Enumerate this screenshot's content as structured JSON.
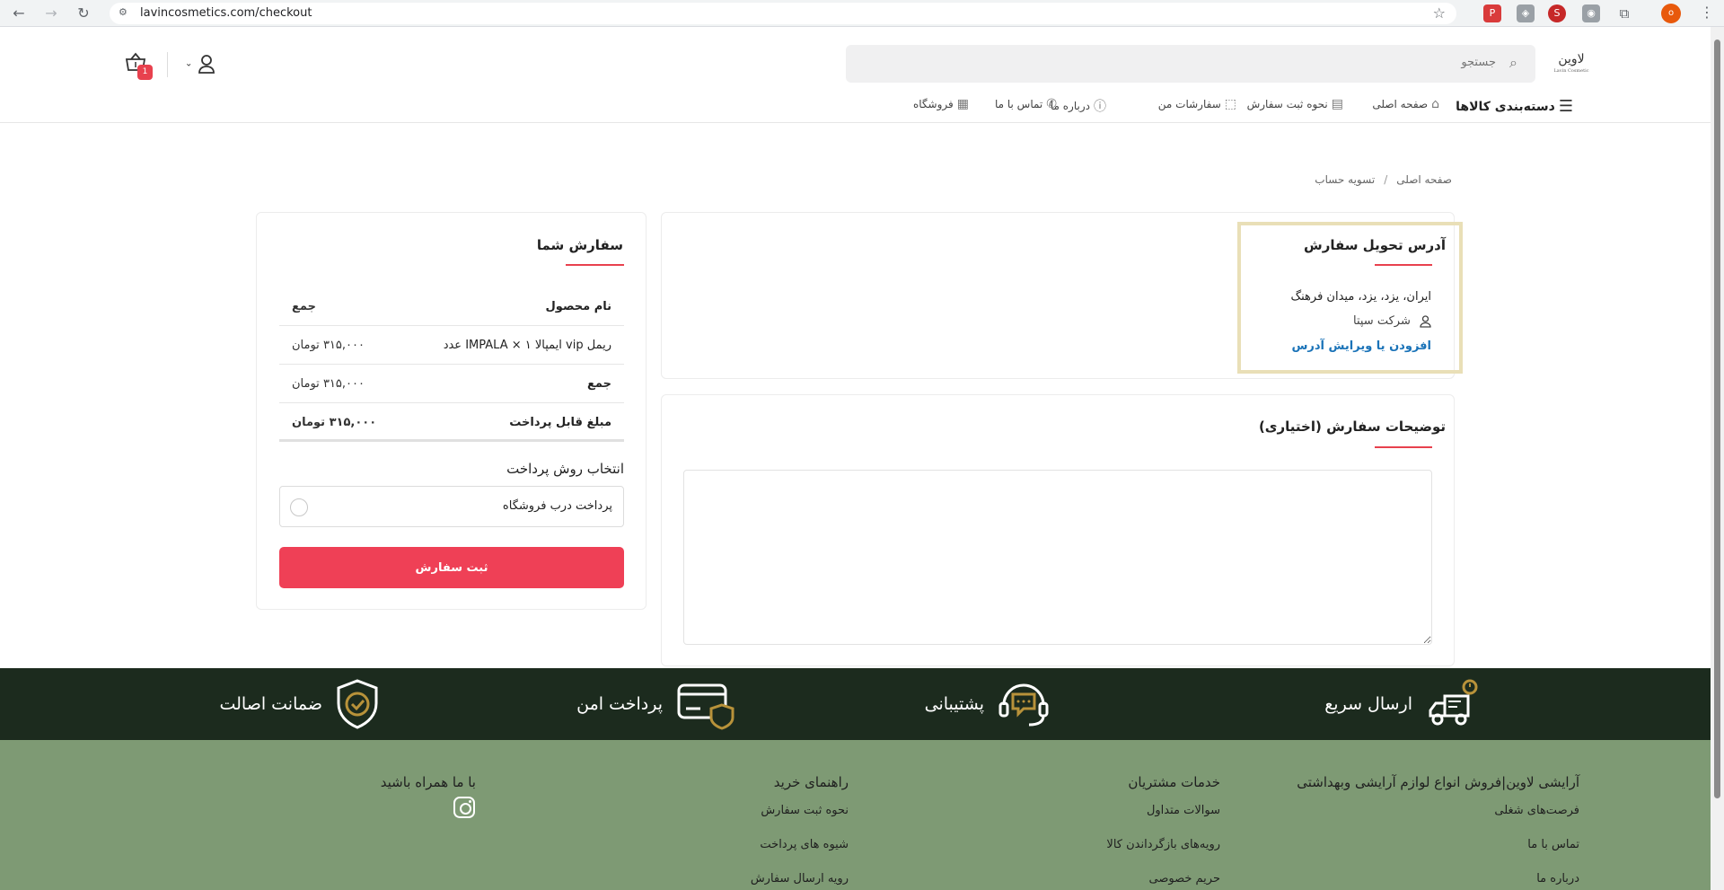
{
  "browser": {
    "url": "lavincosmetics.com/checkout",
    "profile_initial": "o"
  },
  "header": {
    "logo_text": "لاوین",
    "logo_sub": "Lavin Cosmetic",
    "search_placeholder": "جستجو",
    "cart_count": "1",
    "nav": {
      "categories": "دسته‌بندی کالاها",
      "home": "صفحه اصلی",
      "how_to_order": "نحوه ثبت سفارش",
      "my_orders": "سفارشات من",
      "about": "درباره ما",
      "contact": "تماس با ما",
      "store": "فروشگاه"
    }
  },
  "breadcrumb": {
    "home": "صفحه اصلی",
    "separator": "/",
    "current": "تسویه حساب"
  },
  "address": {
    "title": "آدرس تحویل سفارش",
    "line": "ایران، یزد، یزد، میدان فرهنگ",
    "company": "شرکت سپتا",
    "edit_link": "افزودن یا ویرایش آدرس"
  },
  "notes": {
    "title": "توضیحات سفارش (اختیاری)",
    "value": ""
  },
  "order": {
    "title": "سفارش شما",
    "col_product": "نام محصول",
    "col_total": "جمع",
    "items": [
      {
        "name": "ریمل vip ایمپالا IMPALA × ۱ عدد",
        "total": "۳۱۵,۰۰۰ تومان"
      }
    ],
    "subtotal_label": "جمع",
    "subtotal": "۳۱۵,۰۰۰ تومان",
    "payable_label": "مبلغ قابل پرداخت",
    "payable": "۳۱۵,۰۰۰ تومان",
    "payment_title": "انتخاب روش پرداخت",
    "payment_option": "پرداخت درب فروشگاه",
    "submit": "ثبت سفارش"
  },
  "features": {
    "fast_shipping": "ارسال سریع",
    "support": "پشتیبانی",
    "secure_payment": "پرداخت امن",
    "authenticity": "ضمانت اصالت"
  },
  "footer": {
    "about": {
      "title": "آرایشی لاوین|فروش انواع لوازم آرایشی وبهداشتی",
      "links": [
        "فرصت‌های شغلی",
        "تماس با ما",
        "درباره ما"
      ]
    },
    "services": {
      "title": "خدمات مشتریان",
      "links": [
        "سوالات متداول",
        "رویه‌های بازگرداندن کالا",
        "حریم خصوصی"
      ]
    },
    "guide": {
      "title": "راهنمای خرید",
      "links": [
        "نحوه ثبت سفارش",
        "شیوه های پرداخت",
        "رویه ارسال سفارش"
      ]
    },
    "social": {
      "title": "با ما همراه باشید"
    }
  },
  "colors": {
    "accent": "#ef4056",
    "features_bg": "#1c2b1e",
    "footer_bg": "#7e9a74",
    "icon_gold": "#b8923a"
  }
}
